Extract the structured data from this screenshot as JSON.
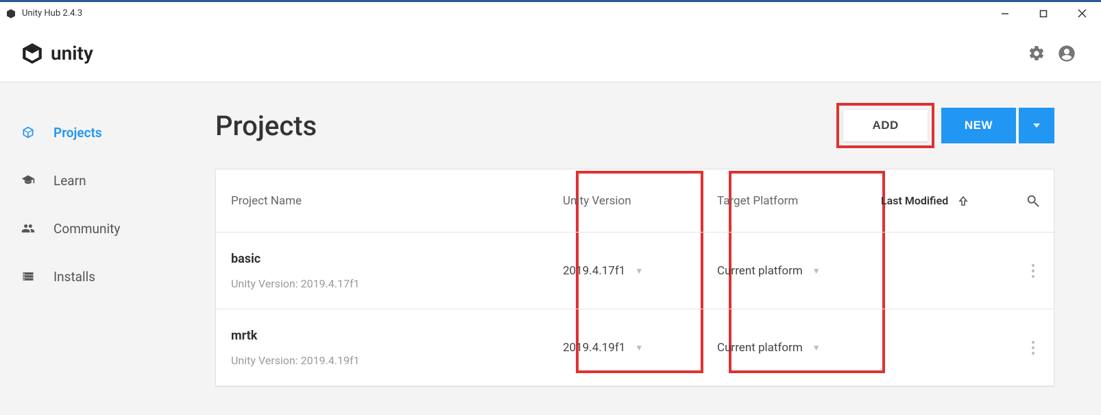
{
  "window": {
    "title": "Unity Hub 2.4.3"
  },
  "header": {
    "app_name": "unity"
  },
  "sidebar": {
    "items": [
      {
        "label": "Projects"
      },
      {
        "label": "Learn"
      },
      {
        "label": "Community"
      },
      {
        "label": "Installs"
      }
    ]
  },
  "main": {
    "title": "Projects",
    "add_label": "ADD",
    "new_label": "NEW",
    "columns": {
      "name": "Project Name",
      "version": "Unity Version",
      "platform": "Target Platform",
      "modified": "Last Modified"
    },
    "version_prefix": "Unity Version: ",
    "rows": [
      {
        "name": "basic",
        "version": "2019.4.17f1",
        "platform": "Current platform",
        "sub_version": "2019.4.17f1"
      },
      {
        "name": "mrtk",
        "version": "2019.4.19f1",
        "platform": "Current platform",
        "sub_version": "2019.4.19f1"
      }
    ]
  }
}
